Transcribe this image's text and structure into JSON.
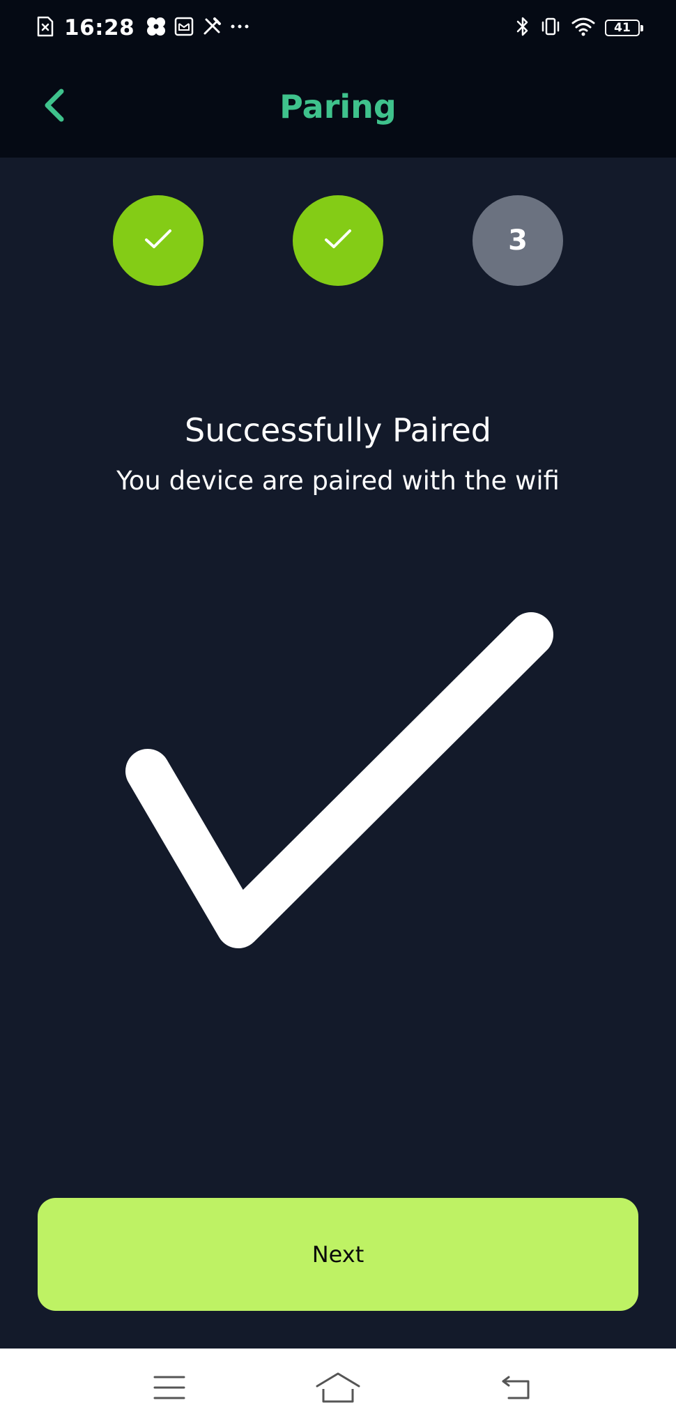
{
  "status_bar": {
    "time": "16:28",
    "battery_level": "41",
    "left_icons": [
      "sim-card-icon",
      "fan-icon",
      "mail-box-icon",
      "tools-icon",
      "more-dots-icon"
    ],
    "right_icons": [
      "bluetooth-icon",
      "vibrate-icon",
      "wifi-icon",
      "battery-icon"
    ]
  },
  "header": {
    "title": "Paring",
    "back_icon": "chevron-left-icon"
  },
  "stepper": {
    "steps": [
      {
        "state": "completed",
        "icon": "check-icon"
      },
      {
        "state": "completed",
        "icon": "check-icon"
      },
      {
        "state": "current",
        "label": "3"
      }
    ]
  },
  "result": {
    "heading": "Successfully Paired",
    "message": "You device are paired with the wifi",
    "icon": "large-checkmark-icon"
  },
  "actions": {
    "next_label": "Next"
  },
  "nav_bar": {
    "items": [
      "menu-icon",
      "home-icon",
      "back-icon"
    ]
  },
  "colors": {
    "background": "#131a2a",
    "header_background": "#050a14",
    "title": "#3fc28c",
    "step_completed": "#84cc16",
    "step_current": "#6b7280",
    "button": "#bef264",
    "button_text": "#0a0a0a",
    "text": "#ffffff"
  }
}
